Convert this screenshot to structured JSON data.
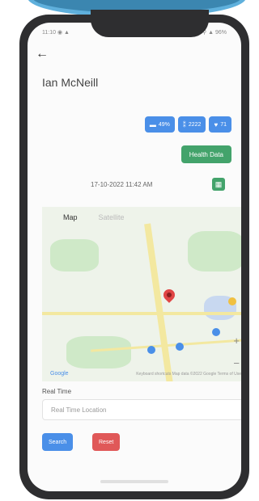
{
  "status_bar": {
    "left": "11:10 ◉ ▲",
    "right": "⚲ ▲ 96%"
  },
  "header": {
    "back_icon": "arrow-left-icon",
    "title": "Ian McNeill"
  },
  "badges": [
    {
      "icon": "battery-icon",
      "label": "49%"
    },
    {
      "icon": "footprints-icon",
      "label": "2222"
    },
    {
      "icon": "heart-icon",
      "label": "71"
    }
  ],
  "health_button": "Health Data",
  "datetime": "17-10-2022 11:42 AM",
  "calendar_icon": "calendar-icon",
  "map": {
    "tabs": [
      "Map",
      "Satellite"
    ],
    "active_tab": "Map",
    "google_logo": "Google",
    "attribution": "Keyboard shortcuts  Map data ©2022 Google  Terms of Use",
    "zoom_in": "+",
    "zoom_out": "−"
  },
  "real_time": {
    "label": "Real Time",
    "placeholder": "Real Time Location"
  },
  "buttons": {
    "search": "Search",
    "reset": "Reset"
  },
  "colors": {
    "primary": "#4a8fe8",
    "success": "#43a36b",
    "danger": "#e05858",
    "accent_blob": "#3b86b0"
  }
}
